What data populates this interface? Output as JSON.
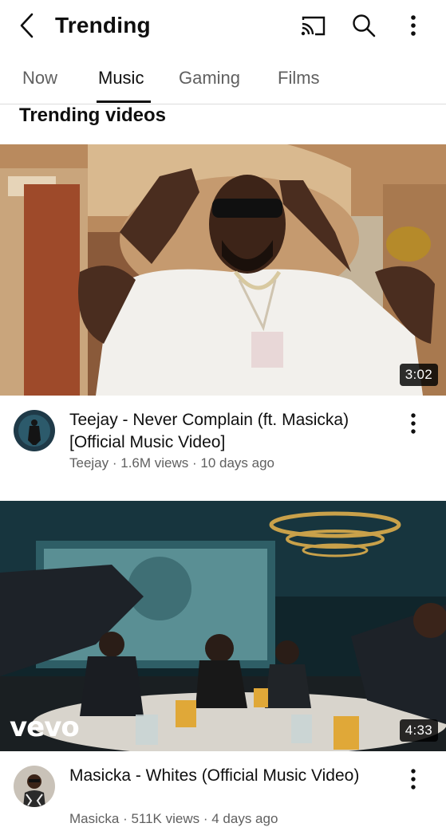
{
  "header": {
    "title": "Trending",
    "back_icon": "chevron-left-icon",
    "cast_icon": "cast-icon",
    "search_icon": "search-icon",
    "more_icon": "more-vert-icon"
  },
  "tabs": [
    {
      "label": "Now",
      "active": false
    },
    {
      "label": "Music",
      "active": true
    },
    {
      "label": "Gaming",
      "active": false
    },
    {
      "label": "Films",
      "active": false
    }
  ],
  "section": {
    "title": "Trending videos"
  },
  "videos": [
    {
      "title": "Teejay - Never Complain (ft. Masicka) [Official Music Video]",
      "channel": "Teejay",
      "views": "1.6M views",
      "age": "10 days ago",
      "meta": "Teejay · 1.6M views · 10 days ago",
      "duration": "3:02"
    },
    {
      "title": "Masicka - Whites (Official Music Video)",
      "channel": "Masicka",
      "views": "511K views",
      "age": "4 days ago",
      "meta": "Masicka · 511K views · 4 days ago",
      "duration": "4:33",
      "badge": "vevo"
    }
  ],
  "colors": {
    "text": "#0f0f0f",
    "secondary": "#606060",
    "divider": "#dcdcdc"
  }
}
